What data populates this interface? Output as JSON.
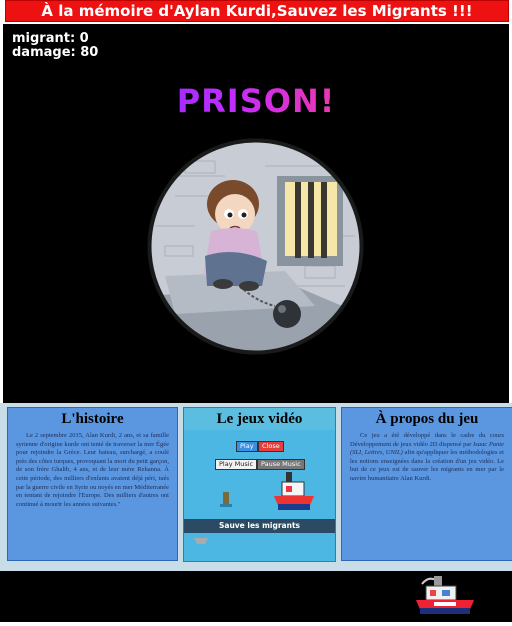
{
  "banner": {
    "text": "À la mémoire d'Aylan Kurdi,Sauvez les Migrants !!!"
  },
  "game": {
    "hud": {
      "migrant": "migrant: 0",
      "damage": "damage: 80"
    },
    "status_title": "PRISON!"
  },
  "cards": {
    "history": {
      "title": "L'histoire",
      "text": "Le 2 septembre 2015, Alan Kurdi, 2 ans, et sa famille syrienne d'origine kurde ont tenté de traverser la mer Égée pour rejoindre la Grèce. Leur bateau, surchargé, a coulé près des côtes turques, provoquant la mort du petit garçon, de son frère Ghalib, 4 ans, et de leur mère Rehanna. À cette période, des milliers d'enfants avaient déjà péri, tués par la guerre civile en Syrie ou noyés en mer Méditerranée en tentant de rejoindre l'Europe. Des milliers d'autres ont continué à mourir les années suivantes.\""
    },
    "video": {
      "title": "Le jeux vidéo",
      "play": "Play",
      "close": "Close",
      "play_music": "Play Music",
      "pause_music": "Pause Music",
      "bar_text": "Sauve les migrants"
    },
    "about": {
      "title": "À propos du jeu",
      "text_before": "Ce jeu a été développé dans le cadre du cours Développement de jeux vidéo 2D dispensé par ",
      "author": "Isaac Pante (SLI, Lettres, UNIL)",
      "text_after": " afin qu'appliquer les méthodologies et les notions enseignées dans la création d'un jeu vidéo. Le but de ce jeux est de sauver les migrants en mer par le navire humanitaire Alan Kurdi."
    }
  },
  "colors": {
    "banner": "#e11111",
    "card_blue": "#5b96e0",
    "video_water": "#4cb7e3",
    "game_bg": "#000000"
  }
}
